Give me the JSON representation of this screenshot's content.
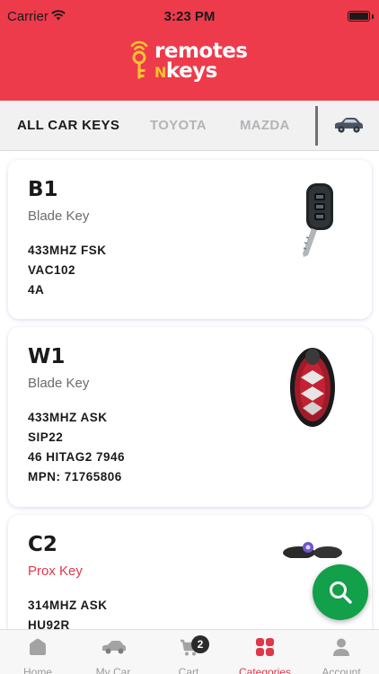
{
  "status_bar": {
    "carrier": "Carrier",
    "time": "3:23 PM"
  },
  "brand": {
    "line1": "remotes",
    "line2_prefix": "N",
    "line2": "keys",
    "accent_color": "#ee3b4b",
    "logo_yellow": "#f6c431"
  },
  "tabs": [
    {
      "label": "ALL CAR KEYS",
      "active": true
    },
    {
      "label": "TOYOTA",
      "active": false
    },
    {
      "label": "MAZDA",
      "active": false
    }
  ],
  "tab_car_icon": "car-icon",
  "products": [
    {
      "code": "B1",
      "type": "Blade Key",
      "specs": [
        "433MHZ FSK",
        "VAC102",
        "4A"
      ]
    },
    {
      "code": "W1",
      "type": "Blade Key",
      "specs": [
        "433MHZ ASK",
        "SIP22",
        "46 HITAG2 7946",
        "MPN: 71765806"
      ]
    },
    {
      "code": "C2",
      "type": "Prox Key",
      "specs": [
        "314MHZ ASK",
        "HU92R"
      ]
    }
  ],
  "search_fab": {
    "icon": "search-icon",
    "color": "#12a04a"
  },
  "bottom_nav": [
    {
      "label": "Home",
      "icon": "home-icon"
    },
    {
      "label": "My Car",
      "icon": "car-icon"
    },
    {
      "label": "Cart",
      "icon": "cart-icon",
      "badge": "2"
    },
    {
      "label": "Categories",
      "icon": "grid-icon",
      "active": true
    },
    {
      "label": "Account",
      "icon": "user-icon"
    }
  ]
}
